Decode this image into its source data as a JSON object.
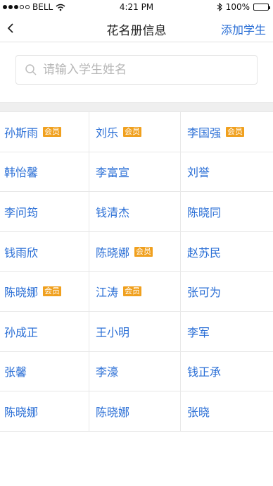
{
  "status_bar": {
    "carrier": "BELL",
    "time": "4:21 PM",
    "battery": "100%"
  },
  "nav": {
    "title": "花名册信息",
    "action": "添加学生"
  },
  "search": {
    "placeholder": "请输入学生姓名"
  },
  "member_badge": "会员",
  "students": [
    [
      {
        "name": "孙斯雨",
        "member": true
      },
      {
        "name": "刘乐",
        "member": true
      },
      {
        "name": "李国强",
        "member": true
      }
    ],
    [
      {
        "name": "韩怡馨",
        "member": false
      },
      {
        "name": "李富宣",
        "member": false
      },
      {
        "name": "刘誉",
        "member": false
      }
    ],
    [
      {
        "name": "李问筠",
        "member": false
      },
      {
        "name": "钱清杰",
        "member": false
      },
      {
        "name": "陈晓同",
        "member": false
      }
    ],
    [
      {
        "name": "钱雨欣",
        "member": false
      },
      {
        "name": "陈晓娜",
        "member": true
      },
      {
        "name": "赵苏民",
        "member": false
      }
    ],
    [
      {
        "name": "陈晓娜",
        "member": true
      },
      {
        "name": "江涛",
        "member": true
      },
      {
        "name": "张可为",
        "member": false
      }
    ],
    [
      {
        "name": "孙成正",
        "member": false
      },
      {
        "name": "王小明",
        "member": false
      },
      {
        "name": "李军",
        "member": false
      }
    ],
    [
      {
        "name": "张馨",
        "member": false
      },
      {
        "name": "李濠",
        "member": false
      },
      {
        "name": "钱正承",
        "member": false
      }
    ],
    [
      {
        "name": "陈晓娜",
        "member": false
      },
      {
        "name": "陈晓娜",
        "member": false
      },
      {
        "name": "张晓",
        "member": false
      }
    ]
  ],
  "colors": {
    "link": "#2b6fd6",
    "badge": "#f0a01e",
    "divider": "#efefef"
  }
}
